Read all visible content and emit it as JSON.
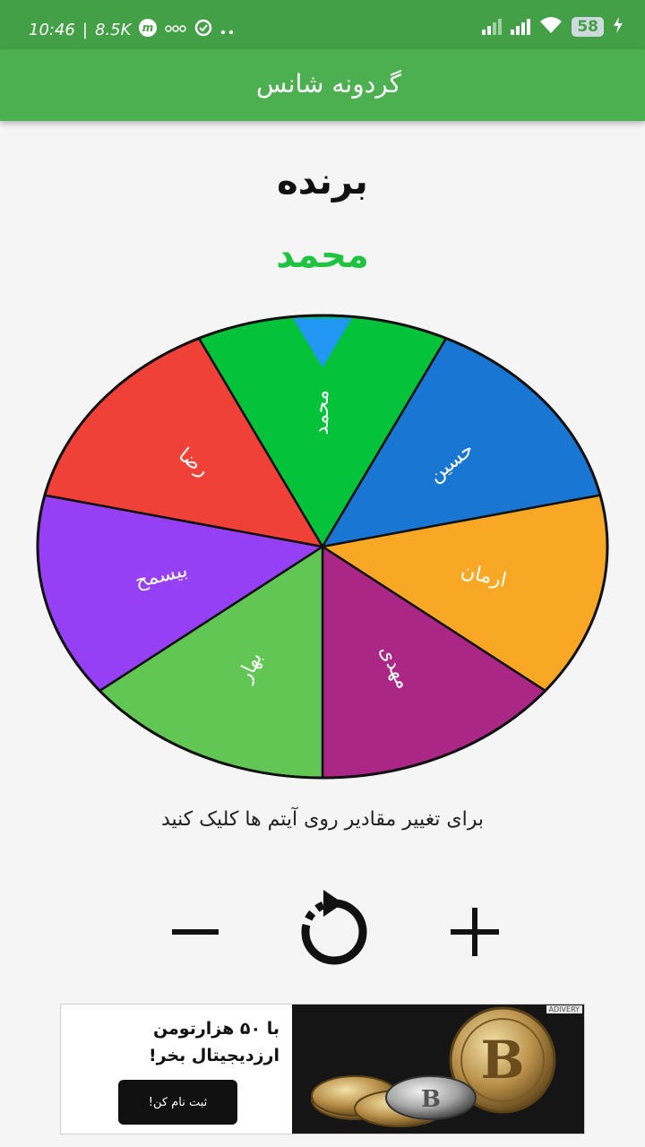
{
  "status_bar": {
    "time": "10:46",
    "separator": "|",
    "net_speed": "8.5K",
    "battery": "58"
  },
  "app_bar": {
    "title": "گردونه شانس"
  },
  "winner": {
    "label": "برنده",
    "name": "محمد"
  },
  "wheel": {
    "segments": [
      {
        "label": "محمد",
        "color": "#04c33a"
      },
      {
        "label": "حسین",
        "color": "#1976d2"
      },
      {
        "label": "ارمان",
        "color": "#f9a825"
      },
      {
        "label": "مهدی",
        "color": "#ab2786"
      },
      {
        "label": "بهار",
        "color": "#62c655"
      },
      {
        "label": "بیسمح",
        "color": "#9540f5"
      },
      {
        "label": "رضا",
        "color": "#f04138"
      }
    ],
    "pointer_color": "#2196f3"
  },
  "hint": "برای تغییر مقادیر روی آیتم ها کلیک کنید",
  "ad": {
    "line1": "با ۵۰ هزارتومن",
    "line2": "ارزدیجیتال بخر!",
    "cta": "ثبت نام کن!",
    "badge": "ADIVERY"
  }
}
